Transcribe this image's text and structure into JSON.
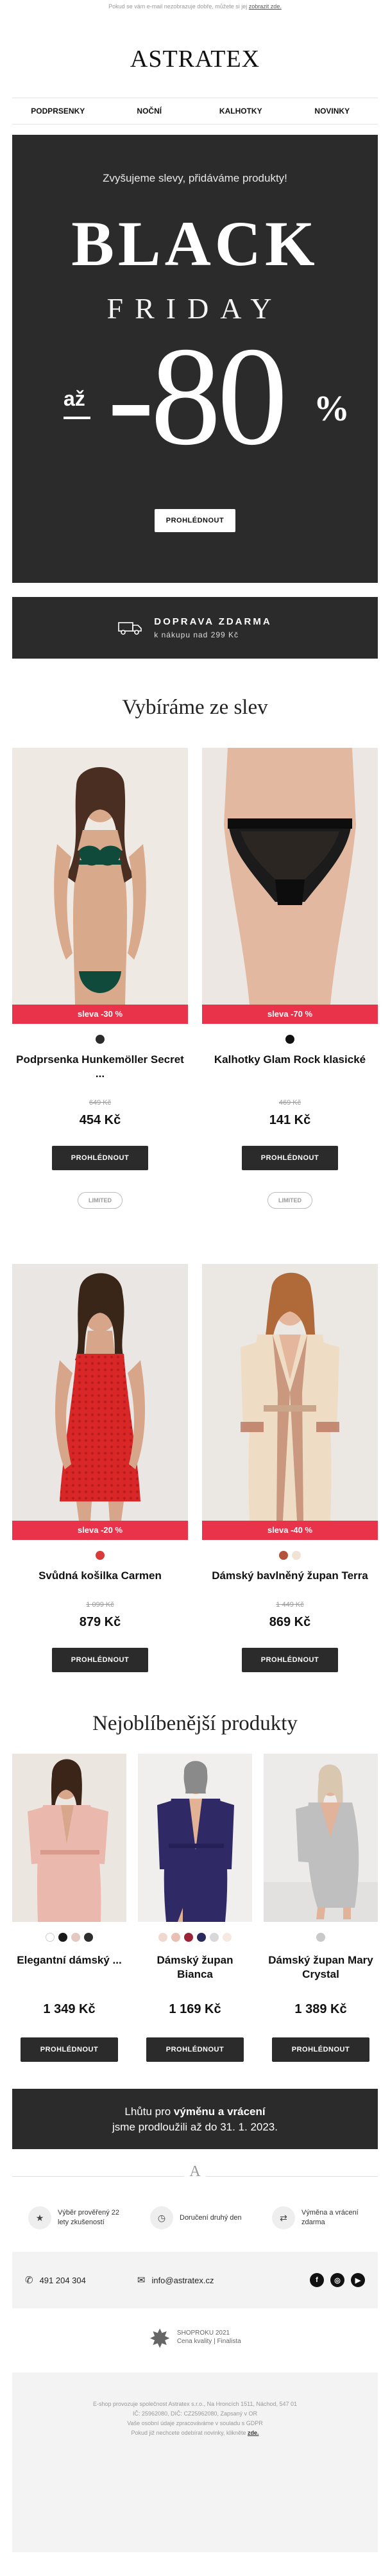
{
  "preheader": {
    "text": "Pokud se vám e-mail nezobrazuje dobře, můžete si jej",
    "link": "zobrazit zde."
  },
  "logo": "ASTRATEX",
  "nav": [
    "PODPRSENKY",
    "NOČNÍ",
    "KALHOTKY",
    "NOVINKY"
  ],
  "hero": {
    "tagline": "Zvyšujeme slevy, přidáváme produkty!",
    "line1": "BLACK",
    "line2": "FRIDAY",
    "prefix": "až",
    "amount": "80",
    "percent": "%",
    "button": "PROHLÉDNOUT"
  },
  "shipping": {
    "title": "DOPRAVA ZDARMA",
    "subtitle": "k nákupu nad 299 Kč"
  },
  "sale_section": {
    "title": "Vybíráme ze slev",
    "products": [
      {
        "badge": "sleva -30 %",
        "name": "Podprsenka Hunkemöller Secret ...",
        "old_price": "649 Kč",
        "price": "454 Kč",
        "button": "PROHLÉDNOUT",
        "tag": "LIMITED",
        "swatches": [
          "#2b2b2b"
        ]
      },
      {
        "badge": "sleva -70 %",
        "name": "Kalhotky Glam Rock klasické",
        "old_price": "469 Kč",
        "price": "141 Kč",
        "button": "PROHLÉDNOUT",
        "tag": "LIMITED",
        "swatches": [
          "#111111"
        ]
      },
      {
        "badge": "sleva -20 %",
        "name": "Svůdná košilka Carmen",
        "old_price": "1 099 Kč",
        "price": "879 Kč",
        "button": "PROHLÉDNOUT",
        "tag": "",
        "swatches": [
          "#d93a3a"
        ]
      },
      {
        "badge": "sleva -40 %",
        "name": "Dámský bavlněný župan Terra",
        "old_price": "1 449 Kč",
        "price": "869 Kč",
        "button": "PROHLÉDNOUT",
        "tag": "",
        "swatches": [
          "#b5523b",
          "#f1e3d4"
        ]
      }
    ]
  },
  "popular_section": {
    "title": "Nejoblíbenější produkty",
    "products": [
      {
        "name": "Elegantní dámský ...",
        "price": "1 349 Kč",
        "button": "PROHLÉDNOUT",
        "swatches": [
          "#ffffff",
          "#1a1a1a",
          "#e3c9c2",
          "#2e2e2e"
        ]
      },
      {
        "name": "Dámský župan Bianca",
        "price": "1 169 Kč",
        "button": "PROHLÉDNOUT",
        "swatches": [
          "#efd9cf",
          "#eabfb4",
          "#9b2335",
          "#2b2a5c",
          "#d8d8d8",
          "#f6e9e2"
        ]
      },
      {
        "name": "Dámský župan Mary Crystal",
        "price": "1 389 Kč",
        "button": "PROHLÉDNOUT",
        "swatches": [
          "#c9c9c9"
        ]
      }
    ]
  },
  "extension": {
    "line1_pre": "Lhůtu pro ",
    "line1_bold": "výměnu a vrácení",
    "line2": "jsme prodloužili až do 31. 1. 2023."
  },
  "divider_mark": "A",
  "usps": [
    {
      "icon": "star-badge-icon",
      "glyph": "★",
      "text": "Výběr prověřený 22 lety zkušeností"
    },
    {
      "icon": "clock-icon",
      "glyph": "◷",
      "text": "Doručení druhý den"
    },
    {
      "icon": "exchange-icon",
      "glyph": "⇄",
      "text": "Výměna a vrácení zdarma"
    }
  ],
  "contact": {
    "phone": "491 204 304",
    "email": "info@astratex.cz"
  },
  "social": [
    "f",
    "◎",
    "▶"
  ],
  "award": {
    "line1": "SHOPROKU 2021",
    "line2": "Cena kvality | Finalista"
  },
  "footer": {
    "line1": "E-shop provozuje společnost Astratex s.r.o., Na Hroncích 1511, Náchod, 547 01",
    "line2": "IČ: 25962080, DIČ: CZ25962080, Zapsaný v OR",
    "line3": "Vaše osobní údaje zpracováváme v souladu s GDPR",
    "line4_pre": "Pokud již nechcete odebírat novinky, klikněte",
    "line4_link": "zde."
  }
}
